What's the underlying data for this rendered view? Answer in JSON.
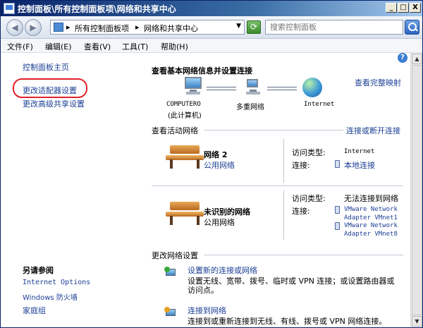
{
  "window": {
    "title": "控制面板\\所有控制面板项\\网络和共享中心",
    "minimize": "_",
    "maximize": "□",
    "close": "X"
  },
  "address": {
    "crumbs": [
      "所有控制面板项",
      "网络和共享中心"
    ],
    "search_placeholder": "搜索控制面板"
  },
  "menu": [
    "文件(F)",
    "编辑(E)",
    "查看(V)",
    "工具(T)",
    "帮助(H)"
  ],
  "sidebar": {
    "home": "控制面板主页",
    "change_adapter": "更改适配器设置",
    "change_sharing": "更改高级共享设置",
    "see_also_title": "另请参阅",
    "see_also": [
      "Internet Options",
      "Windows 防火墙",
      "家庭组"
    ]
  },
  "main": {
    "heading": "查看基本网络信息并设置连接",
    "view_full_map": "查看完整映射",
    "map": {
      "computer_line1": "COMPUTERO",
      "computer_line2": "(此计算机)",
      "multi": "多重网络",
      "internet": "Internet"
    },
    "active_title": "查看活动网络",
    "connect_disconnect": "连接或断开连接",
    "networks": [
      {
        "name": "网络  2",
        "type": "公用网络",
        "access_label": "访问类型:",
        "access_value": "Internet",
        "conn_label": "连接:",
        "conn_values": [
          "本地连接"
        ]
      },
      {
        "name": "未识别的网络",
        "type": "公用网络",
        "access_label": "访问类型:",
        "access_value": "无法连接到网络",
        "conn_label": "连接:",
        "conn_values": [
          "VMware Network",
          "Adapter VMnet1",
          "VMware Network",
          "Adapter VMnet8"
        ]
      }
    ],
    "change_title": "更改网络设置",
    "tasks": [
      {
        "link": "设置新的连接或网络",
        "desc1": "设置无线、宽带、拨号、临时或 VPN 连接；或设置路由器或",
        "desc2": "访问点。"
      },
      {
        "link": "连接到网络",
        "desc1": "连接到或重新连接到无线、有线、拨号或 VPN 网络连接。"
      }
    ]
  },
  "colors": {
    "link": "#1c3f95",
    "highlight_ring": "#e1232b"
  }
}
